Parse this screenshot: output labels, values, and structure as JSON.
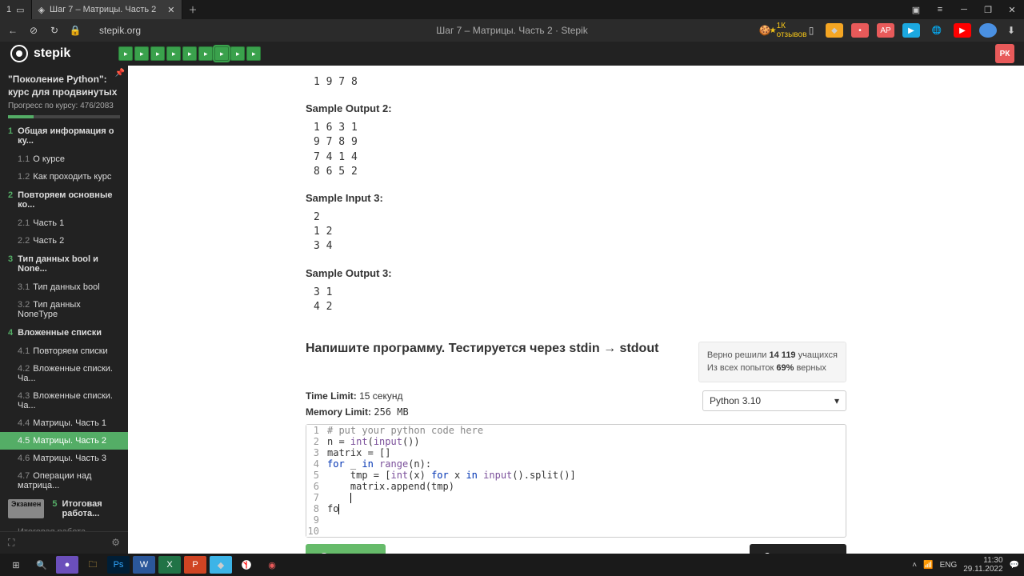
{
  "browser": {
    "tab_count": "1",
    "tab_title": "Шаг 7 – Матрицы. Часть 2",
    "url": "stepik.org",
    "page_title": "Шаг 7 – Матрицы. Часть 2 · Stepik",
    "reviews_badge": "1К отзывов",
    "ext_ap": "AP"
  },
  "header": {
    "logo": "stepik",
    "avatar": "РК"
  },
  "sidebar": {
    "course_title": "\"Поколение Python\": курс для продвинутых",
    "progress_label": "Прогресс по курсу:  476/2083",
    "sections": [
      {
        "num": "1",
        "title": "Общая информация о ку...",
        "items": [
          {
            "sub": "1.1",
            "label": "О курсе"
          },
          {
            "sub": "1.2",
            "label": "Как проходить курс"
          }
        ]
      },
      {
        "num": "2",
        "title": "Повторяем основные ко...",
        "items": [
          {
            "sub": "2.1",
            "label": "Часть 1"
          },
          {
            "sub": "2.2",
            "label": "Часть 2"
          }
        ]
      },
      {
        "num": "3",
        "title": "Тип данных bool и None...",
        "items": [
          {
            "sub": "3.1",
            "label": "Тип данных bool"
          },
          {
            "sub": "3.2",
            "label": "Тип данных NoneType"
          }
        ]
      },
      {
        "num": "4",
        "title": "Вложенные списки",
        "items": [
          {
            "sub": "4.1",
            "label": "Повторяем списки"
          },
          {
            "sub": "4.2",
            "label": "Вложенные списки. Ча..."
          },
          {
            "sub": "4.3",
            "label": "Вложенные списки. Ча..."
          },
          {
            "sub": "4.4",
            "label": "Матрицы. Часть 1"
          },
          {
            "sub": "4.5",
            "label": "Матрицы. Часть 2",
            "active": true
          },
          {
            "sub": "4.6",
            "label": "Матрицы. Часть 3"
          },
          {
            "sub": "4.7",
            "label": "Операции над матрица..."
          }
        ]
      },
      {
        "num": "5",
        "title": "Итоговая работа...",
        "exam": true,
        "items": [
          {
            "sub": "",
            "label": "Итоговая работа"
          }
        ]
      }
    ],
    "exam_badge": "Экзамен"
  },
  "problem": {
    "pre_output": "1 9 7 8",
    "sample_output_2_label": "Sample Output 2:",
    "sample_output_2": "1 6 3 1\n9 7 8 9\n7 4 1 4\n8 6 5 2",
    "sample_input_3_label": "Sample Input 3:",
    "sample_input_3": "2\n1 2\n3 4",
    "sample_output_3_label": "Sample Output 3:",
    "sample_output_3": "3 1\n4 2",
    "task_title": "Напишите программу. Тестируется через stdin → stdout",
    "stats_line1_a": "Верно решили ",
    "stats_line1_b": "14 119",
    "stats_line1_c": " учащихся",
    "stats_line2_a": "Из всех попыток ",
    "stats_line2_b": "69%",
    "stats_line2_c": " верных",
    "time_limit_label": "Time Limit: ",
    "time_limit_value": "15 секунд",
    "memory_limit_label": "Memory Limit: ",
    "memory_limit_value": "256 MB",
    "language": "Python 3.10",
    "code": {
      "l1": "# put your python code here",
      "l2a": "n = ",
      "l2b": "int",
      "l2c": "(",
      "l2d": "input",
      "l2e": "())",
      "l3": "matrix = []",
      "l4a": "for",
      "l4b": " _ ",
      "l4c": "in",
      "l4d": " ",
      "l4e": "range",
      "l4f": "(n):",
      "l5a": "    tmp = [",
      "l5b": "int",
      "l5c": "(x) ",
      "l5d": "for",
      "l5e": " x ",
      "l5f": "in",
      "l5g": " ",
      "l5h": "input",
      "l5i": "().split()]",
      "l6": "    matrix.append(tmp)",
      "l7": "    ",
      "l8": "fo",
      "l9": "",
      "l10": ""
    },
    "submit": "Отправить",
    "run": "Запустить код"
  },
  "taskbar": {
    "lang": "ENG",
    "time": "11:30",
    "date": "29.11.2022"
  }
}
